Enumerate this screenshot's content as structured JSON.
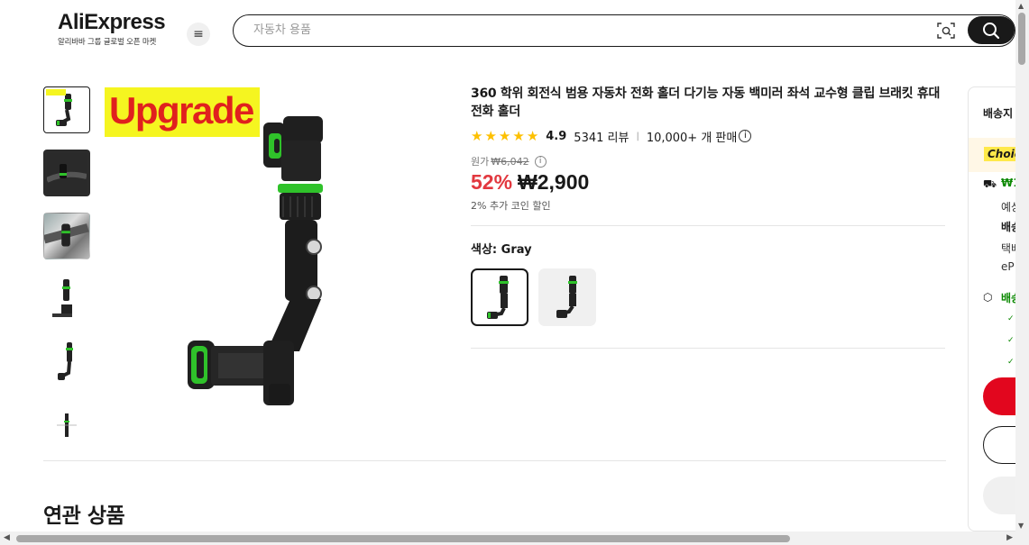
{
  "header": {
    "logo": "AliExpress",
    "logo_sub": "알리바바 그룹 글로벌 오픈 마켓",
    "menu_icon": "hamburger-menu-icon",
    "search_placeholder": "자동차 용품",
    "camera_icon": "camera-search-icon",
    "search_icon": "search-icon"
  },
  "gallery": {
    "badge_text": "Upgrade",
    "thumbnail_count": 6,
    "selected_index": 0
  },
  "product": {
    "title": "360 학위 회전식 범용 자동차 전화 홀더 다기능 자동 백미러 좌석 교수형 클립 브래킷 휴대 전화 홀더",
    "stars": 5,
    "rating": "4.9",
    "reviews": "5341 리뷰",
    "separator": "|",
    "sold": "10,000+ 개 판매",
    "original_label": "원가",
    "original_price": "₩6,042",
    "discount": "52%",
    "price": "₩2,900",
    "coin_discount": "2% 추가 코인 할인",
    "color_label": "색상: Gray",
    "selected_variant": 0
  },
  "shipping_panel": {
    "title": "배송지",
    "choice_tag": "Choice",
    "shipping_price": "₩1",
    "line1": "예상",
    "line2": "배송",
    "line3": "택배",
    "line4": "eP",
    "guarantee": "배송",
    "colors": {
      "buy": "#e2061e",
      "green": "#0a8800"
    }
  },
  "related": {
    "title": "연관 상품"
  },
  "colors": {
    "discount": "#e2383f",
    "star": "#fdc000",
    "badge_bg": "#f5f520",
    "badge_text": "#e0201e",
    "product_green": "#2fc22a"
  }
}
